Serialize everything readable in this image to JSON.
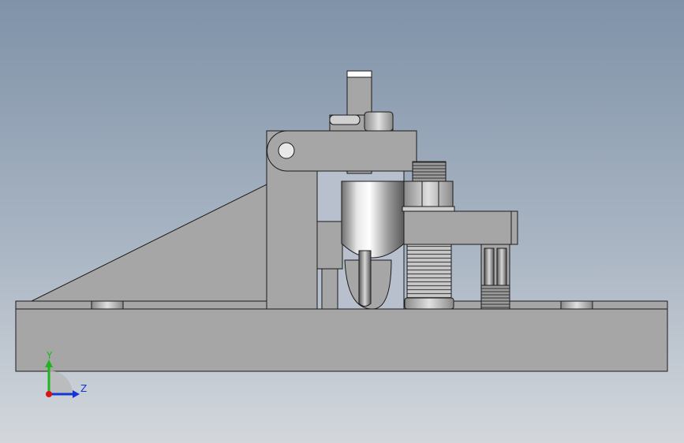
{
  "viewport": {
    "background_top": "#7f92a8",
    "background_bottom": "#d3d7dc"
  },
  "part_color": "#a6a6a6",
  "edge_color": "#1a1a1a",
  "triad": {
    "y_label": "Y",
    "z_label": "Z",
    "y_color": "#1fb51f",
    "z_color": "#1436d8",
    "x_color": "#d81414"
  }
}
